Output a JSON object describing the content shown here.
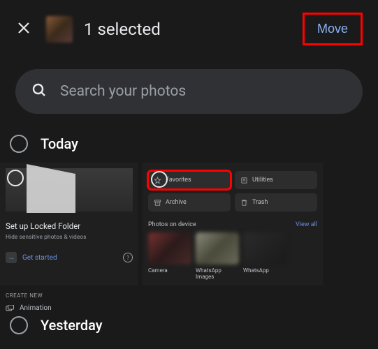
{
  "header": {
    "title": "1 selected",
    "move_label": "Move"
  },
  "search": {
    "placeholder": "Search your photos"
  },
  "sections": {
    "today": "Today",
    "yesterday": "Yesterday"
  },
  "locked_folder": {
    "title": "Set up Locked Folder",
    "subtitle": "Hide sensitive photos & videos",
    "cta": "Get started"
  },
  "create": {
    "heading": "CREATE NEW",
    "animation": "Animation"
  },
  "library_chips": {
    "favorites": "Favorites",
    "utilities": "Utilities",
    "archive": "Archive",
    "trash": "Trash"
  },
  "photos_on_device": {
    "heading": "Photos on device",
    "view_all": "View all",
    "albums": [
      "Camera",
      "WhatsApp Images",
      "WhatsApp"
    ]
  }
}
